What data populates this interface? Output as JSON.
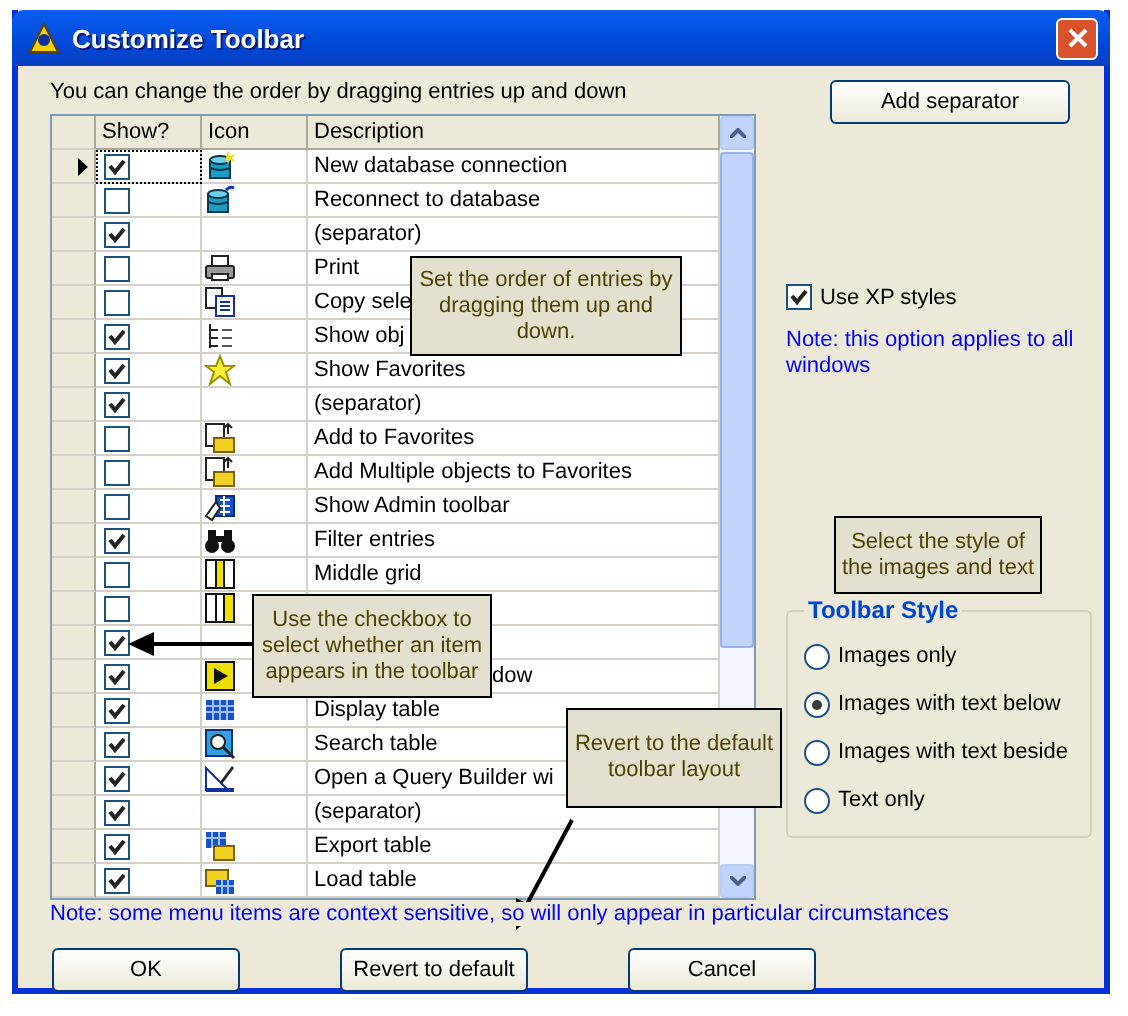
{
  "window": {
    "title": "Customize Toolbar"
  },
  "instructions": "You can change the order by dragging entries up and down",
  "table": {
    "columns": [
      "Show?",
      "Icon",
      "Description"
    ],
    "rows": [
      {
        "selected": true,
        "show": true,
        "kind": "database",
        "description": "New database connection"
      },
      {
        "selected": false,
        "show": false,
        "kind": "database-reconnect",
        "description": "Reconnect to database"
      },
      {
        "selected": false,
        "show": true,
        "kind": "none",
        "description": "(separator)"
      },
      {
        "selected": false,
        "show": false,
        "kind": "printer",
        "description": "Print"
      },
      {
        "selected": false,
        "show": false,
        "kind": "copy",
        "description": "Copy sele"
      },
      {
        "selected": false,
        "show": true,
        "kind": "tree",
        "description": "Show obj"
      },
      {
        "selected": false,
        "show": true,
        "kind": "star",
        "description": "Show Favorites"
      },
      {
        "selected": false,
        "show": true,
        "kind": "none",
        "description": "(separator)"
      },
      {
        "selected": false,
        "show": false,
        "kind": "folder-add",
        "description": "Add to Favorites"
      },
      {
        "selected": false,
        "show": false,
        "kind": "folder-add",
        "description": "Add Multiple objects to Favorites"
      },
      {
        "selected": false,
        "show": false,
        "kind": "admin",
        "description": "Show Admin toolbar"
      },
      {
        "selected": false,
        "show": true,
        "kind": "binoculars",
        "description": "Filter entries"
      },
      {
        "selected": false,
        "show": false,
        "kind": "grid-middle",
        "description": "Middle grid"
      },
      {
        "selected": false,
        "show": false,
        "kind": "grid-right"
      },
      {
        "selected": false,
        "show": true,
        "kind": "none"
      },
      {
        "selected": false,
        "show": true,
        "kind": "play",
        "description": "dow",
        "start_hidden": true
      },
      {
        "selected": false,
        "show": true,
        "kind": "table",
        "description": "Display table"
      },
      {
        "selected": false,
        "show": true,
        "kind": "search-table",
        "description": "Search table"
      },
      {
        "selected": false,
        "show": true,
        "kind": "query",
        "description": "Open a Query Builder wi"
      },
      {
        "selected": false,
        "show": true,
        "kind": "none",
        "description": "(separator)"
      },
      {
        "selected": false,
        "show": true,
        "kind": "export",
        "description": "Export table"
      },
      {
        "selected": false,
        "show": true,
        "kind": "load",
        "description": "Load table"
      }
    ]
  },
  "note": "Note: some menu items are context sensitive, so will only appear in particular circumstances",
  "add_separator_button": "Add separator",
  "xp_styles": {
    "label": "Use XP styles",
    "checked": true
  },
  "xp_note": "Note: this option applies to all windows",
  "toolbar_style": {
    "title": "Toolbar Style",
    "options": [
      {
        "label": "Images only",
        "selected": false
      },
      {
        "label": "Images with text below",
        "selected": true
      },
      {
        "label": "Images with text beside",
        "selected": false
      },
      {
        "label": "Text only",
        "selected": false
      }
    ]
  },
  "buttons": [
    "OK",
    "Revert to default",
    "Cancel"
  ],
  "callouts": [
    {
      "text": "Set the order of entries by dragging them up and down."
    },
    {
      "text": "Use the checkbox to select whether an item appears in the toolbar"
    },
    {
      "text": "Revert to the default toolbar layout"
    },
    {
      "text": "Select the style of the images and text"
    }
  ]
}
